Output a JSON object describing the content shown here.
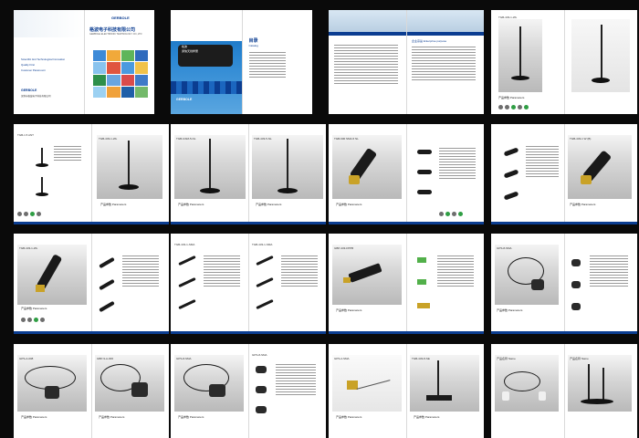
{
  "company": {
    "brand": "GERBOLE",
    "name_cn": "格波电子科技有限公司",
    "name_en": "GERBOLE ELECTRONIC TECHNOLOGY CO.,LTD",
    "tagline_rows": [
      "Scientific And Technological Innovation",
      "Quality First",
      "Customer Paramount"
    ],
    "back_cover_lines": [
      "深圳市格波电子科技有限公司"
    ]
  },
  "catalog": {
    "title_cn": "目录",
    "title_en": "Catalog",
    "cover_lines": [
      "格波",
      "通信天线样册",
      "GERBOLE",
      "Communication Antenna"
    ]
  },
  "labels": {
    "params": "产品参数 Parameters",
    "enterprise_purpose": "企业宗旨 Enterprise purpose",
    "header_strip": "格波电子科技有限公司"
  },
  "pages": [
    {
      "title": "TGB-433-1-WL"
    },
    {
      "title": "TGB-1.5 ANT"
    },
    {
      "title": "TGB-433-1-WL"
    },
    {
      "title": "TGB-GSM-5-NL"
    },
    {
      "title": "TGB-433-5-NL"
    },
    {
      "title": "TGB-900 SMA-5 NL"
    },
    {
      "title": "TGB-433-1 W (B)"
    },
    {
      "title": "TGB-433-1-WL"
    },
    {
      "title": "TGB-433-1-SMA"
    },
    {
      "title": "TGB-433-1-SMA"
    },
    {
      "title": "GBP-433-FPPB"
    },
    {
      "title": "GPS-8-SMA"
    },
    {
      "title": "GPS-A-008"
    },
    {
      "title": "GBP-9-A-006"
    },
    {
      "title": "GPS-8-SMA"
    },
    {
      "title": "GPS-8-SMA"
    },
    {
      "title": "GPS-2-SMA"
    },
    {
      "title": "TGB-433-8-SE"
    },
    {
      "title": "产品名称 Name"
    },
    {
      "title": "产品名称 Name"
    }
  ],
  "colors": {
    "navy": "#0b3d91",
    "background": "#0a0a0a",
    "gold": "#c9a227"
  }
}
